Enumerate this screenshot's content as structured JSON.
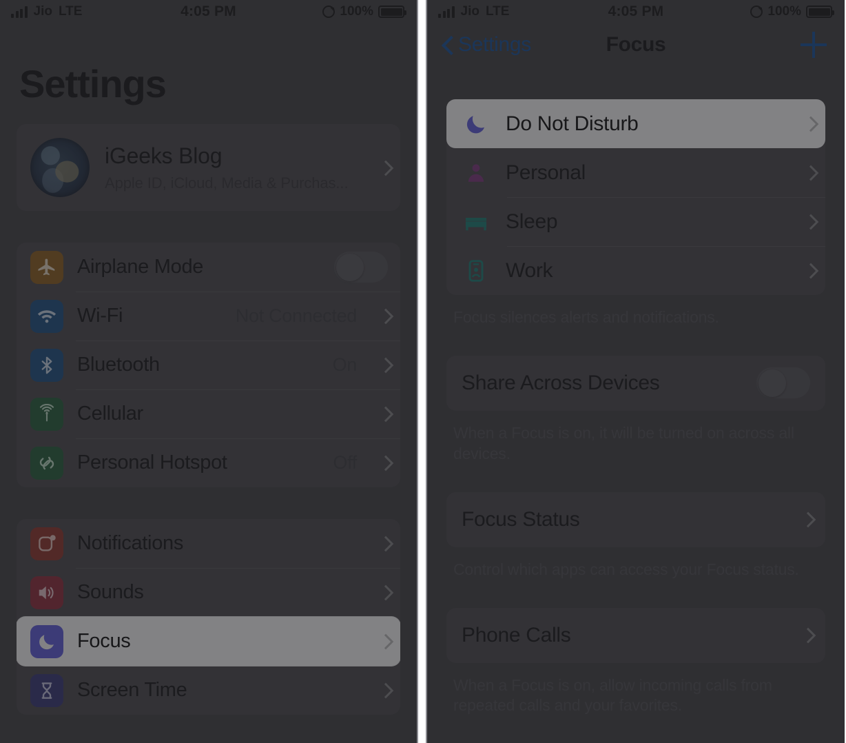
{
  "status_bar": {
    "carrier": "Jio",
    "network": "LTE",
    "time": "4:05 PM",
    "battery_percent": "100%",
    "signal_icon": "signal-bars-icon",
    "orientation_lock_icon": "rotation-lock-icon",
    "battery_icon": "battery-full-icon"
  },
  "left_screen": {
    "title": "Settings",
    "apple_id": {
      "name": "iGeeks Blog",
      "subtitle": "Apple ID, iCloud, Media & Purchas...",
      "avatar_icon": "earth-avatar"
    },
    "group_connectivity": [
      {
        "label": "Airplane Mode",
        "icon": "airplane-icon",
        "color": "#b5710a",
        "control": "toggle",
        "toggle_on": false,
        "value": ""
      },
      {
        "label": "Wi-Fi",
        "icon": "wifi-icon",
        "color": "#1063b8",
        "control": "chevron",
        "value": "Not Connected"
      },
      {
        "label": "Bluetooth",
        "icon": "bluetooth-icon",
        "color": "#1063b8",
        "control": "chevron",
        "value": "On"
      },
      {
        "label": "Cellular",
        "icon": "cellular-antenna-icon",
        "color": "#1d7a3e",
        "control": "chevron",
        "value": ""
      },
      {
        "label": "Personal Hotspot",
        "icon": "hotspot-link-icon",
        "color": "#1d7a3e",
        "control": "chevron",
        "value": "Off"
      }
    ],
    "group_general": [
      {
        "label": "Notifications",
        "icon": "notifications-bell-icon",
        "color": "#c0392b",
        "control": "chevron",
        "value": "",
        "highlighted": false
      },
      {
        "label": "Sounds",
        "icon": "speaker-wave-icon",
        "color": "#c0392b",
        "control": "chevron",
        "value": "",
        "highlighted": false
      },
      {
        "label": "Focus",
        "icon": "crescent-moon-icon",
        "color": "#5a57e0",
        "control": "chevron",
        "value": "",
        "highlighted": true
      },
      {
        "label": "Screen Time",
        "icon": "hourglass-icon",
        "color": "#3b3b8f",
        "control": "chevron",
        "value": "",
        "highlighted": false
      }
    ]
  },
  "right_screen": {
    "nav": {
      "back_label": "Settings",
      "title": "Focus",
      "add_label": "+",
      "back_icon": "chevron-left-icon",
      "add_icon": "plus-icon",
      "accent_color": "#0b4a9a"
    },
    "focus_modes": [
      {
        "label": "Do Not Disturb",
        "icon": "crescent-moon-icon",
        "color": "#5a57e0",
        "highlighted": true
      },
      {
        "label": "Personal",
        "icon": "person-icon",
        "color": "#6b2a6b",
        "highlighted": false
      },
      {
        "label": "Sleep",
        "icon": "bed-icon",
        "color": "#0d6b63",
        "highlighted": false
      },
      {
        "label": "Work",
        "icon": "id-badge-icon",
        "color": "#0d6b63",
        "highlighted": false
      }
    ],
    "focus_modes_footnote": "Focus silences alerts and notifications.",
    "share_across_devices": {
      "label": "Share Across Devices",
      "toggle_on": false,
      "footnote": "When a Focus is on, it will be turned on across all devices."
    },
    "focus_status": {
      "label": "Focus Status",
      "footnote": "Control which apps can access your Focus status."
    },
    "phone_calls": {
      "label": "Phone Calls",
      "footnote": "When a Focus is on, allow incoming calls from repeated calls and your favorites."
    }
  }
}
